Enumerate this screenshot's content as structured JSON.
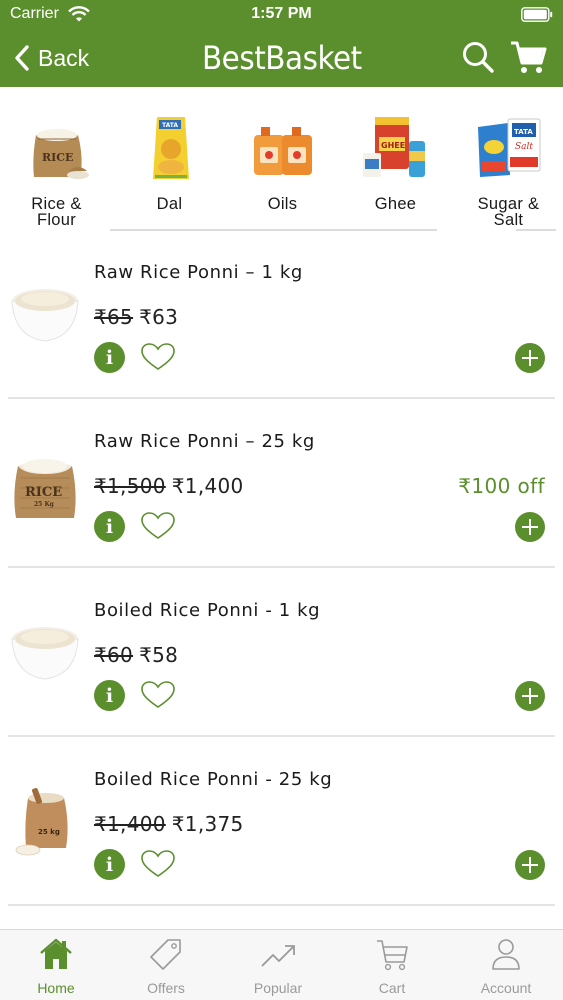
{
  "status_bar": {
    "carrier": "Carrier",
    "time": "1:57 PM"
  },
  "nav": {
    "back_label": "Back",
    "title": "BestBasket"
  },
  "categories": [
    {
      "line1": "Rice &",
      "line2": "Flour"
    },
    {
      "line1": "Dal",
      "line2": ""
    },
    {
      "line1": "Oils",
      "line2": ""
    },
    {
      "line1": "Ghee",
      "line2": ""
    },
    {
      "line1": "Sugar &",
      "line2": "Salt"
    }
  ],
  "products": [
    {
      "name": "Raw Rice Ponni – 1 kg",
      "mrp": "₹65",
      "price": "₹63",
      "discount": ""
    },
    {
      "name": "Raw Rice Ponni – 25 kg",
      "mrp": "₹1,500",
      "price": "₹1,400",
      "discount": "₹100 off"
    },
    {
      "name": "Boiled Rice Ponni - 1 kg",
      "mrp": "₹60",
      "price": "₹58",
      "discount": ""
    },
    {
      "name": "Boiled Rice Ponni - 25 kg",
      "mrp": "₹1,400",
      "price": "₹1,375",
      "discount": ""
    }
  ],
  "product_actions": {
    "info_label": "i"
  },
  "image_labels": {
    "rice_sack": "RICE",
    "sack_weight": "25 Kg",
    "bag_weight": "25 kg",
    "oil_brand": "GHEE",
    "salt_brand": "TATA",
    "salt_word": "Salt",
    "dal_brand": "TATA"
  },
  "tabs": [
    {
      "label": "Home",
      "icon": "home-icon",
      "active": true
    },
    {
      "label": "Offers",
      "icon": "tag-icon",
      "active": false
    },
    {
      "label": "Popular",
      "icon": "trending-icon",
      "active": false
    },
    {
      "label": "Cart",
      "icon": "cart-icon",
      "active": false
    },
    {
      "label": "Account",
      "icon": "user-icon",
      "active": false
    }
  ],
  "colors": {
    "brand": "#5b8f2e",
    "tab_inactive": "#9a9a9a",
    "divider": "#e4e4e4"
  }
}
